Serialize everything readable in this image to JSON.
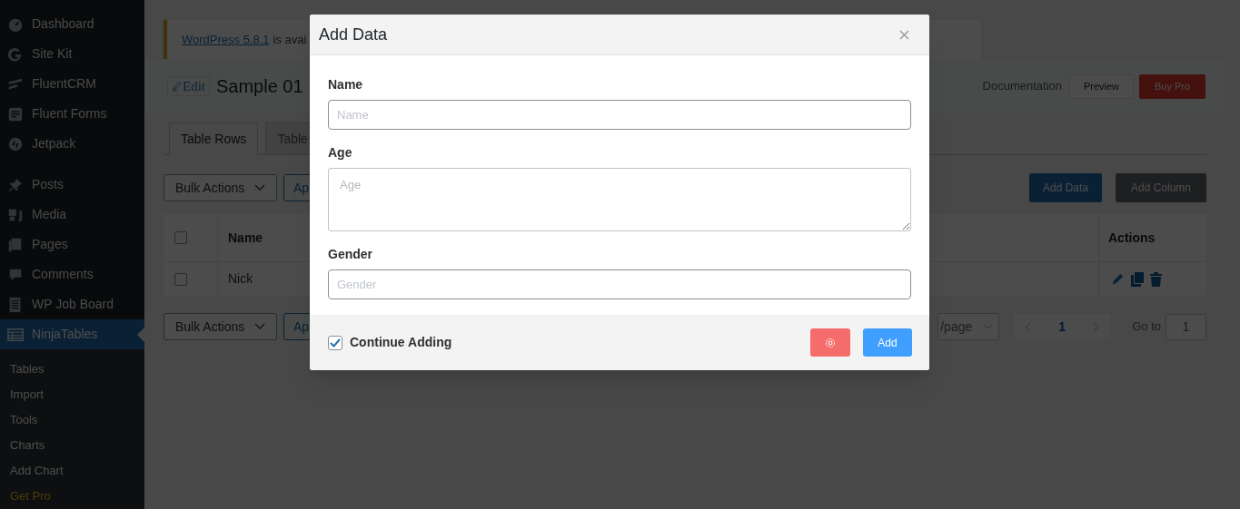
{
  "sidebar": {
    "items": [
      {
        "label": "Dashboard",
        "selected": false
      },
      {
        "label": "Site Kit",
        "selected": false
      },
      {
        "label": "FluentCRM",
        "selected": false
      },
      {
        "label": "Fluent Forms",
        "selected": false
      },
      {
        "label": "Jetpack",
        "selected": false
      },
      {
        "label": "Posts",
        "selected": false
      },
      {
        "label": "Media",
        "selected": false
      },
      {
        "label": "Pages",
        "selected": false
      },
      {
        "label": "Comments",
        "selected": false
      },
      {
        "label": "WP Job Board",
        "selected": false
      },
      {
        "label": "NinjaTables",
        "selected": true,
        "children": [
          {
            "label": "Tables",
            "kind": "link"
          },
          {
            "label": "Import",
            "kind": "link"
          },
          {
            "label": "Tools",
            "kind": "link"
          },
          {
            "label": "Charts",
            "kind": "link"
          },
          {
            "label": "Add Chart",
            "kind": "link"
          },
          {
            "label": "Get Pro",
            "kind": "promo"
          }
        ]
      }
    ]
  },
  "notice": {
    "link": "WordPress 5.8.1",
    "text": "is avai"
  },
  "header": {
    "edit_button": "Edit",
    "title": "Sample 01",
    "documentation": "Documentation",
    "preview_button": "Preview",
    "buy_button": "Buy Pro"
  },
  "tabs": [
    {
      "label": "Table Rows",
      "selected": true
    },
    {
      "label": "Table",
      "selected": false
    }
  ],
  "toolbar": {
    "bulk_actions": "Bulk Actions",
    "apply_button": "Ap",
    "add_data_button": "Add Data",
    "add_column_button": "Add Column"
  },
  "table": {
    "select_all_checked": false,
    "columns": [
      "Name",
      "Actions"
    ],
    "rows": [
      {
        "name": "Nick",
        "checked": false
      }
    ]
  },
  "footer_bar": {
    "bulk_actions": "Bulk Actions",
    "apply_button": "Ap",
    "per_page": "/page",
    "current_page": "1",
    "goto_label": "Go to",
    "goto_value": "1"
  },
  "modal": {
    "title": "Add Data",
    "fields": [
      {
        "label": "Name",
        "placeholder": "Name",
        "kind": "input"
      },
      {
        "label": "Age",
        "placeholder": "Age",
        "kind": "textarea"
      },
      {
        "label": "Gender",
        "placeholder": "Gender",
        "kind": "input"
      }
    ],
    "continue_adding": {
      "label": "Continue Adding",
      "checked": true
    },
    "add_button": "Add"
  }
}
